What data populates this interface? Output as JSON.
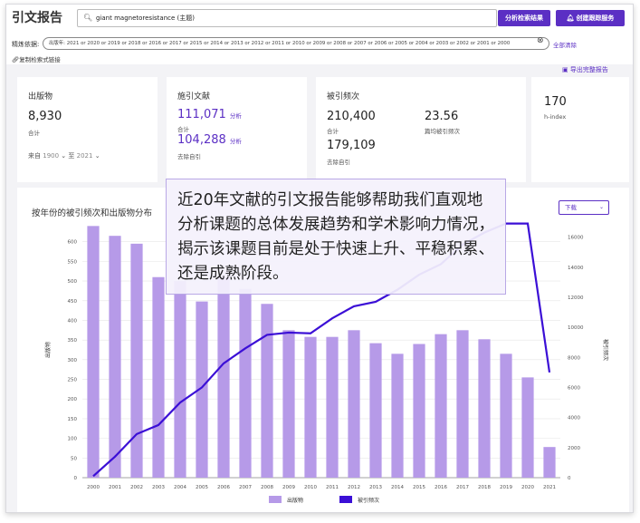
{
  "header": {
    "title": "引文报告",
    "search_value": "giant magnetoresistance (主题)",
    "analyze_button": "分析检索结果",
    "alert_button": "创建跟踪服务"
  },
  "filters": {
    "label": "精炼依据:",
    "chip": "出版年: 2021 or 2020 or 2019 or 2018 or 2016 or 2017 or 2015 or 2014 or 2013 or 2012 or 2011 or 2010 or 2009 or 2008 or 2007 or 2006 or 2005 or 2004 or 2003 or 2002 or 2001 or 2000",
    "clear_all": "全部清除",
    "copy_link": "复制检索式链接",
    "export": "导出完整报告"
  },
  "metrics": {
    "publications": {
      "label": "出版物",
      "value": "8,930",
      "sub": "合计",
      "range_from_label": "来自",
      "range_from": "1900",
      "range_to_label": "至",
      "range_to": "2021"
    },
    "citing": {
      "label": "施引文献",
      "total": "111,071",
      "total_unit": "分析",
      "total_sub": "合计",
      "excl": "104,288",
      "excl_unit": "分析",
      "excl_sub": "去除自引"
    },
    "times_cited": {
      "label": "被引频次",
      "total": "210,400",
      "total_sub": "合计",
      "avg": "23.56",
      "avg_sub": "篇均被引频次",
      "excl": "179,109",
      "excl_sub": "去除自引"
    },
    "h_index": {
      "value": "170",
      "label": "h-index"
    }
  },
  "chart_section": {
    "title": "按年份的被引频次和出版物分布",
    "dropdown": "下载"
  },
  "callout": {
    "text": "近20年文献的引文报告能够帮助我们直观地分析课题的总体发展趋势和学术影响力情况，揭示该课题目前是处于快速上升、平稳积累、还是成熟阶段。"
  },
  "chart_data": {
    "type": "bar",
    "categories": [
      "2000",
      "2001",
      "2002",
      "2003",
      "2004",
      "2005",
      "2006",
      "2007",
      "2008",
      "2009",
      "2010",
      "2011",
      "2012",
      "2013",
      "2014",
      "2015",
      "2016",
      "2017",
      "2018",
      "2019",
      "2020",
      "2021"
    ],
    "series": [
      {
        "name": "出版物",
        "type": "bar",
        "axis": "left",
        "color": "#b69ae8",
        "values": [
          640,
          615,
          595,
          510,
          500,
          448,
          510,
          480,
          442,
          375,
          358,
          358,
          375,
          342,
          315,
          340,
          365,
          375,
          352,
          315,
          255,
          78
        ]
      },
      {
        "name": "被引频次",
        "type": "line",
        "axis": "right",
        "color": "#3b0fd6",
        "values": [
          100,
          1400,
          2900,
          3500,
          5000,
          6000,
          7600,
          8600,
          9500,
          9650,
          9600,
          10600,
          11400,
          11700,
          12500,
          13500,
          14200,
          15500,
          16300,
          16900,
          16900,
          7000
        ]
      }
    ],
    "ylabel_left": "出版物",
    "ylabel_right": "被引频次",
    "ylim_left": [
      0,
      650
    ],
    "ylim_right": [
      0,
      17000
    ],
    "yticks_left": [
      0,
      50,
      100,
      150,
      200,
      250,
      300,
      350,
      400,
      450,
      500,
      550,
      600
    ],
    "yticks_right": [
      0,
      2000,
      4000,
      6000,
      8000,
      10000,
      12000,
      14000,
      16000
    ],
    "grid": true,
    "legend": "bottom-center"
  }
}
